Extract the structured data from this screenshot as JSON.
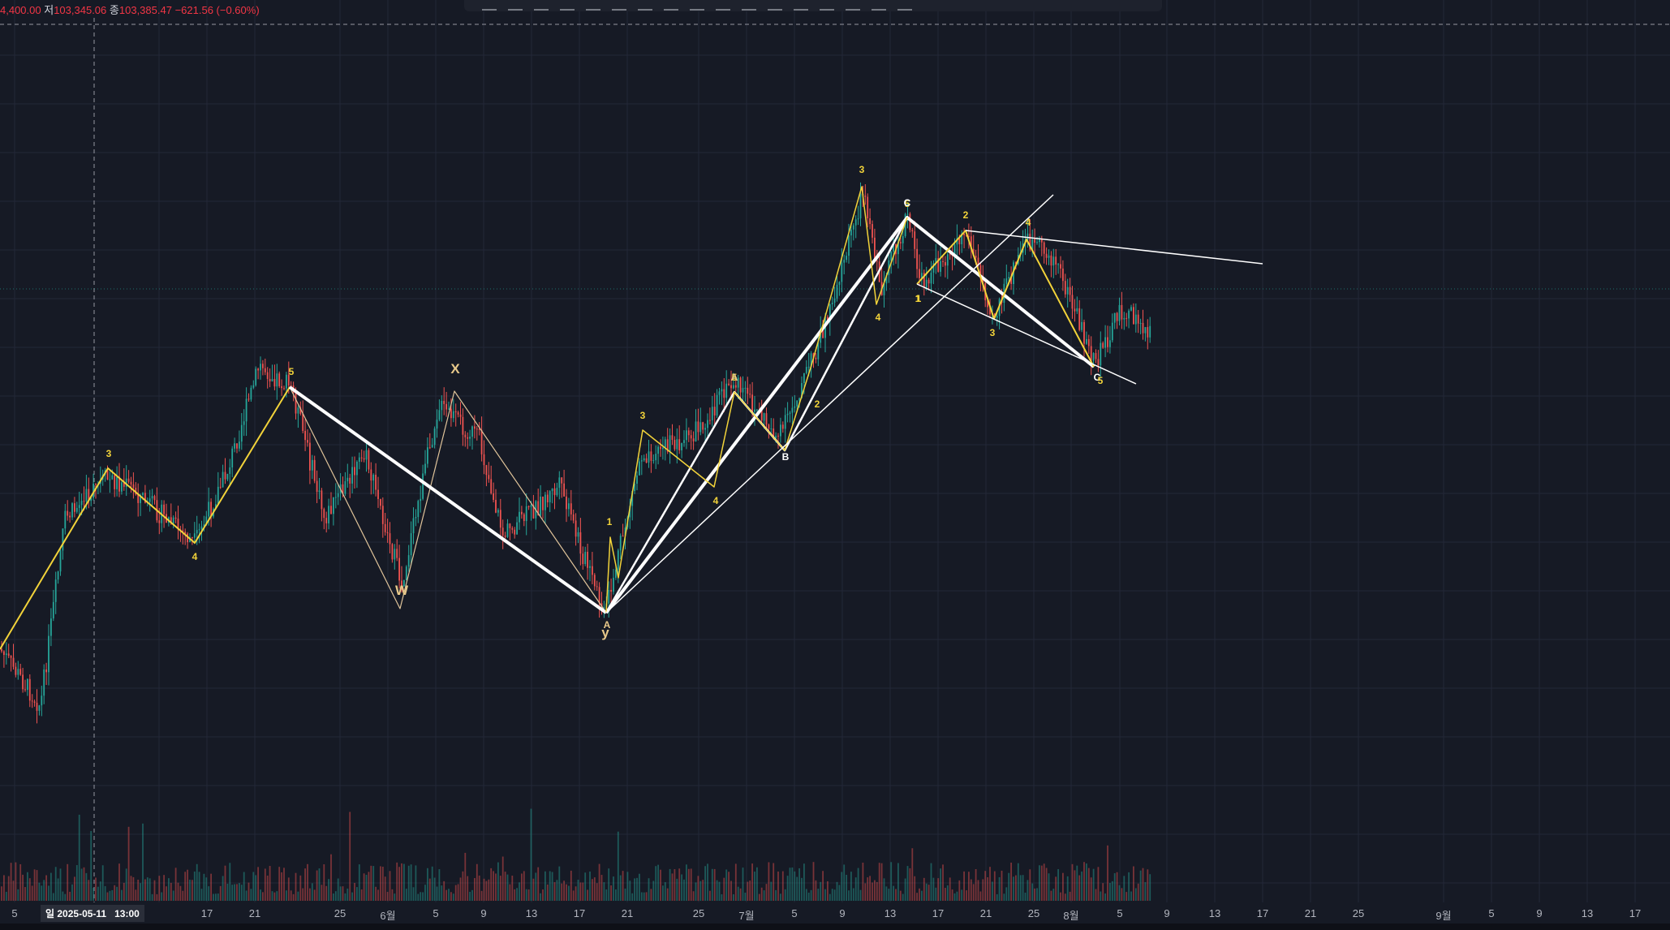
{
  "header": {
    "open_partial": "4,400.00",
    "low_label": "저",
    "low_value": "103,345.06",
    "close_label": "종",
    "close_value": "103,385.47",
    "change": "−621.56 (−0.60%)"
  },
  "toolbar": {
    "icons": [
      "trend-line-icon",
      "fib-icon",
      "horizontal-lines-icon",
      "channel-icon",
      "pitchfork-icon",
      "pattern-icon",
      "wave-icon",
      "cycle-icon",
      "elliott-icon",
      "projection-icon",
      "arrow-icon",
      "brush-icon",
      "path-icon",
      "text-icon",
      "measure-icon",
      "zoom-icon",
      "more-icon"
    ]
  },
  "crosshair": {
    "date_label": "일 2025-05-11",
    "time_label": "13:00"
  },
  "date_axis": {
    "ticks": [
      "5",
      "17",
      "21",
      "25",
      "6월",
      "5",
      "9",
      "13",
      "17",
      "21",
      "25",
      "7월",
      "5",
      "9",
      "13",
      "17",
      "21",
      "25",
      "8월",
      "5",
      "9",
      "13",
      "17",
      "21",
      "25",
      "9월",
      "5",
      "9",
      "13",
      "17"
    ]
  },
  "wave_labels": [
    {
      "text": "3",
      "color": "#f2d33a"
    },
    {
      "text": "4",
      "color": "#f2d33a"
    },
    {
      "text": "5",
      "color": "#f2d33a"
    },
    {
      "text": "W",
      "color": "#e8c98a"
    },
    {
      "text": "X",
      "color": "#e8c98a"
    },
    {
      "text": "y",
      "color": "#e8c98a"
    },
    {
      "text": "A",
      "color": "#e8c98a"
    },
    {
      "text": "1",
      "color": "#f2d33a"
    },
    {
      "text": "3",
      "color": "#f2d33a"
    },
    {
      "text": "4",
      "color": "#f2d33a"
    },
    {
      "text": "5",
      "color": "#f2d33a"
    },
    {
      "text": "A",
      "color": "#e8c98a"
    },
    {
      "text": "B",
      "color": "#ffffff"
    },
    {
      "text": "1",
      "color": "#f2d33a"
    },
    {
      "text": "2",
      "color": "#f2d33a"
    },
    {
      "text": "3",
      "color": "#f2d33a"
    },
    {
      "text": "4",
      "color": "#f2d33a"
    },
    {
      "text": "5",
      "color": "#f2d33a"
    },
    {
      "text": "C",
      "color": "#ffffff"
    },
    {
      "text": "1",
      "color": "#f2d33a"
    },
    {
      "text": "2",
      "color": "#f2d33a"
    },
    {
      "text": "3",
      "color": "#f2d33a"
    },
    {
      "text": "4",
      "color": "#f2d33a"
    },
    {
      "text": "C",
      "color": "#ffffff"
    },
    {
      "text": "5",
      "color": "#f2d33a"
    }
  ],
  "colors": {
    "background": "#161a25",
    "grid": "#232838",
    "up": "#26a69a",
    "down": "#ef5350",
    "wave_yellow": "#f2d33a",
    "wave_tan": "#e0c49a",
    "wave_white": "#ffffff"
  }
}
